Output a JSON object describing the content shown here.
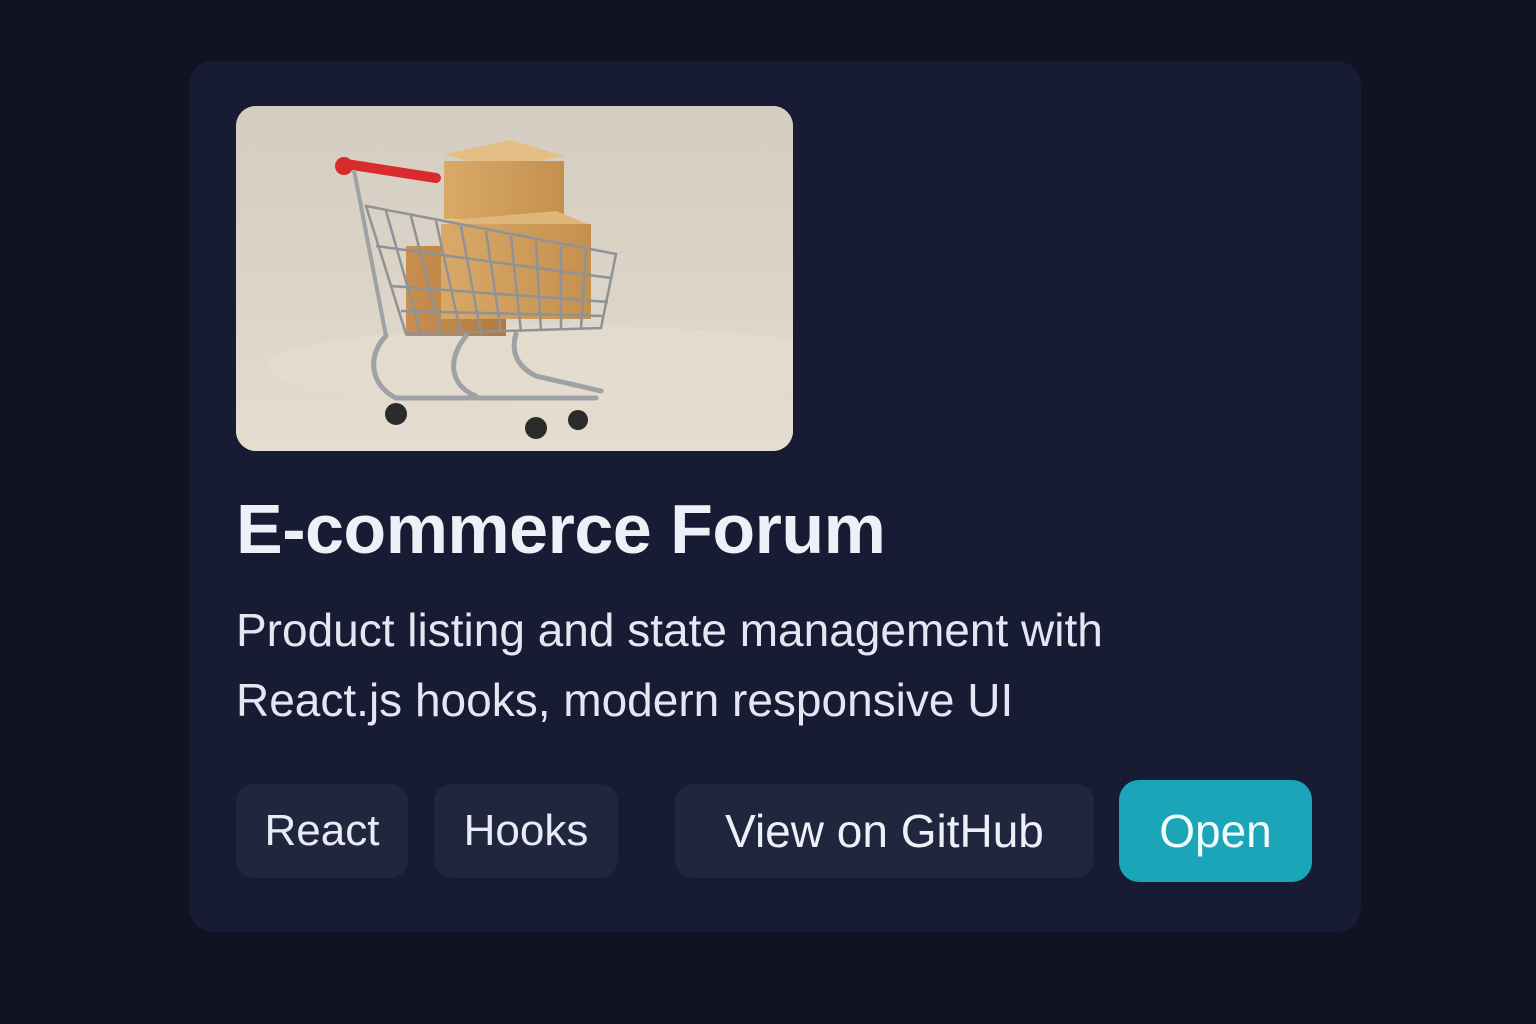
{
  "card": {
    "image": {
      "alt": "shopping-cart-image",
      "icon": "shopping-cart-with-boxes"
    },
    "title": "E-commerce Forum",
    "description_lines": [
      "Product listing and state management with",
      "React.js hooks, modern responsive UI"
    ],
    "tags": [
      "React",
      "Hooks"
    ],
    "actions": {
      "github_label": "View on GitHub",
      "open_label": "Open"
    }
  },
  "colors": {
    "page_background": "#0f1322",
    "card_background": "#171b34",
    "chip_background": "#21263f",
    "accent": "#1aa6b8",
    "text": "#eef0f8"
  }
}
